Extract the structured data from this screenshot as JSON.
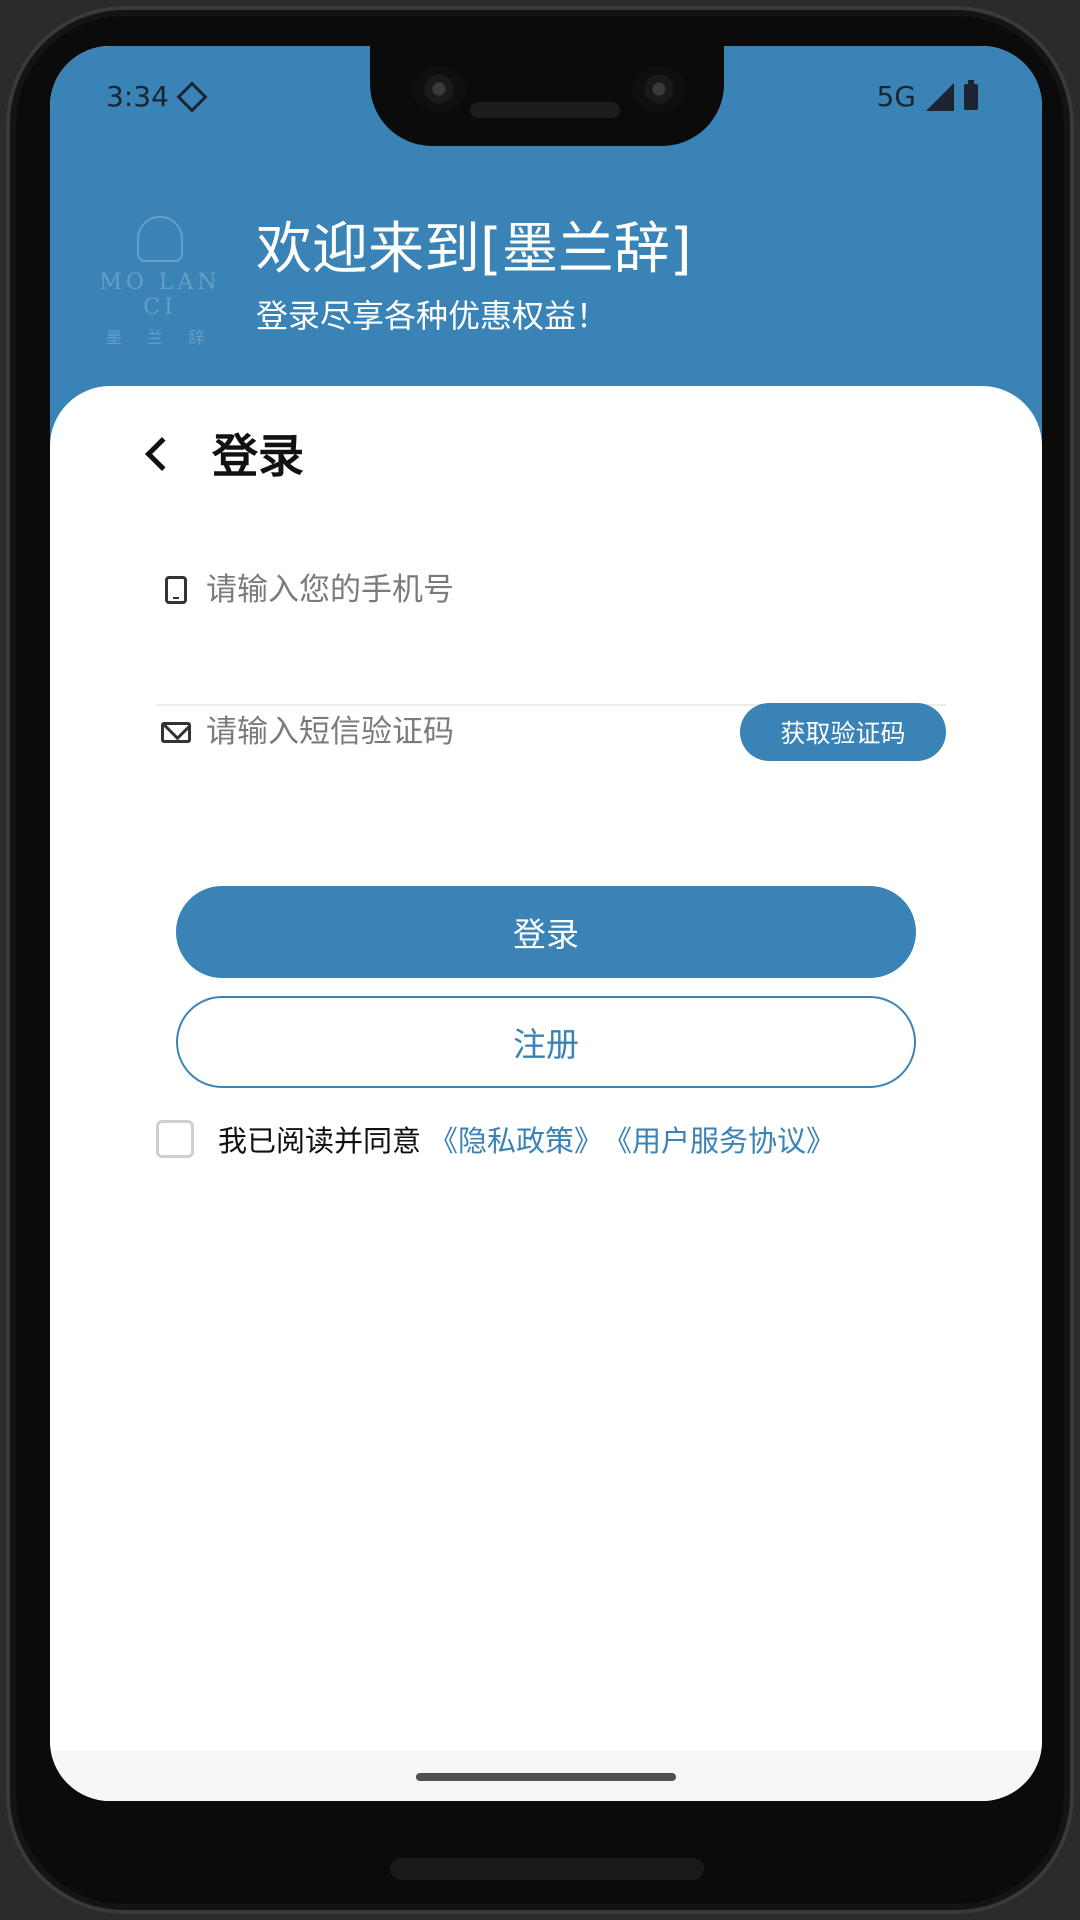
{
  "status_bar": {
    "time": "3:34",
    "network": "5G"
  },
  "logo": {
    "text": "MO LAN CI",
    "sub": "墨 兰 辞"
  },
  "welcome": {
    "title": "欢迎来到[墨兰辞]",
    "subtitle": "登录尽享各种优惠权益！"
  },
  "login_page": {
    "title": "登录",
    "phone_placeholder": "请输入您的手机号",
    "sms_placeholder": "请输入短信验证码",
    "get_code_label": "获取验证码",
    "login_label": "登录",
    "register_label": "注册",
    "agree_text": "我已阅读并同意",
    "privacy_link": "《隐私政策》",
    "service_link": "《用户服务协议》"
  },
  "colors": {
    "accent": "#3a83b6",
    "text": "#111111",
    "placeholder": "#7b7b7b"
  },
  "icons": [
    "diamond-icon",
    "signal-icon",
    "battery-icon",
    "back-icon",
    "phone-icon",
    "mail-icon"
  ]
}
